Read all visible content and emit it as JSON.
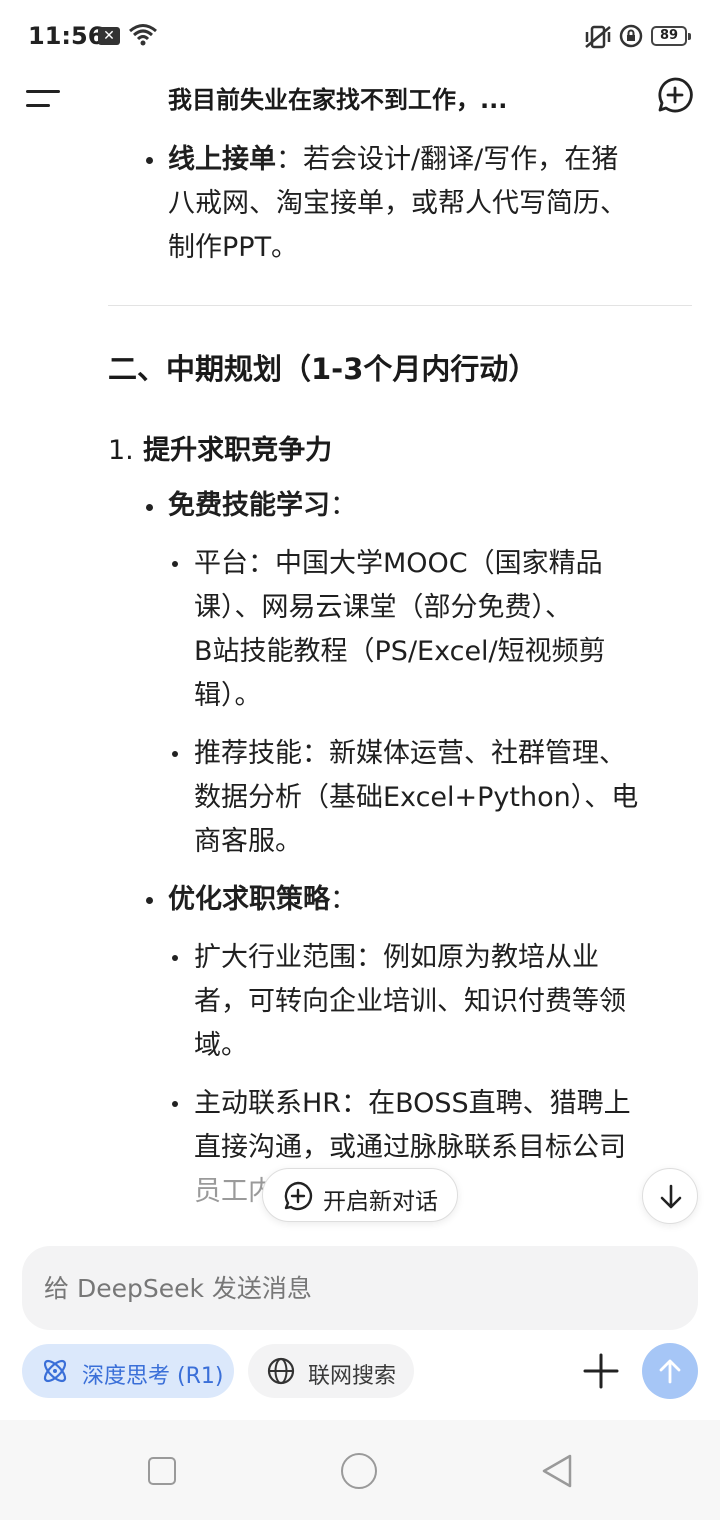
{
  "status_bar": {
    "time": "11:56",
    "notification_badge": "✕",
    "battery_level": "89"
  },
  "header": {
    "title": "我目前失业在家找不到工作，...",
    "menu_icon": "hamburger-menu-icon",
    "new_chat_icon": "new-chat-plus-icon"
  },
  "content": {
    "online_orders": {
      "label": "线上接单",
      "line1": "：若会设计/翻译/写作，在猪",
      "line2": "八戒网、淘宝接单，或帮人代写简历、",
      "line3": "制作PPT。"
    },
    "section2_title": "二、中期规划（1-3个月内行动）",
    "item1": {
      "number": "1.",
      "title": "提升求职竞争力"
    },
    "free_learning": {
      "label": "免费技能学习",
      "suffix": "：",
      "platforms": {
        "line1": "平台：中国大学MOOC（国家精品",
        "line2": "课）、网易云课堂（部分免费）、",
        "line3": "B站技能教程（PS/Excel/短视频剪",
        "line4": "辑）。"
      },
      "skills": {
        "line1": "推荐技能：新媒体运营、社群管理、",
        "line2": "数据分析（基础Excel+Python）、电",
        "line3": "商客服。"
      }
    },
    "optimize": {
      "label": "优化求职策略",
      "suffix": "：",
      "expand": {
        "line1": "扩大行业范围：例如原为教培从业",
        "line2": "者，可转向企业培训、知识付费等领",
        "line3": "域。"
      },
      "contact_hr": {
        "line1": "主动联系HR：在BOSS直聘、猎聘上",
        "line2": "直接沟通，或通过脉脉联系目标公司",
        "line3": "员工内"
      }
    }
  },
  "floating": {
    "new_dialog_label": "开启新对话"
  },
  "input": {
    "placeholder": "给 DeepSeek 发送消息"
  },
  "chips": {
    "deep_think": "深度思考 (R1)",
    "web_search": "联网搜索"
  },
  "colors": {
    "accent": "#3a6fd8",
    "chip_active_bg": "#dbe8fb",
    "send_button": "#a6c6f6"
  }
}
